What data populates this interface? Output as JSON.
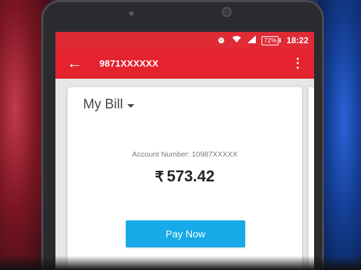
{
  "status_bar": {
    "icons": [
      "alarm-icon",
      "wifi-icon",
      "signal-icon",
      "battery-icon"
    ],
    "battery_percent": "72%",
    "time": "18:22"
  },
  "app_bar": {
    "title": "9871XXXXXX",
    "back_icon": "back-arrow-icon",
    "menu_icon": "more-vert-icon"
  },
  "bill": {
    "heading": "My Bill",
    "account_line": "Account Number: 10987XXXXX",
    "currency_symbol": "₹",
    "amount": "573.42",
    "pay_button_label": "Pay Now"
  },
  "colors": {
    "app_bar_red": "#e4232f",
    "pay_button_blue": "#17a9e8"
  }
}
